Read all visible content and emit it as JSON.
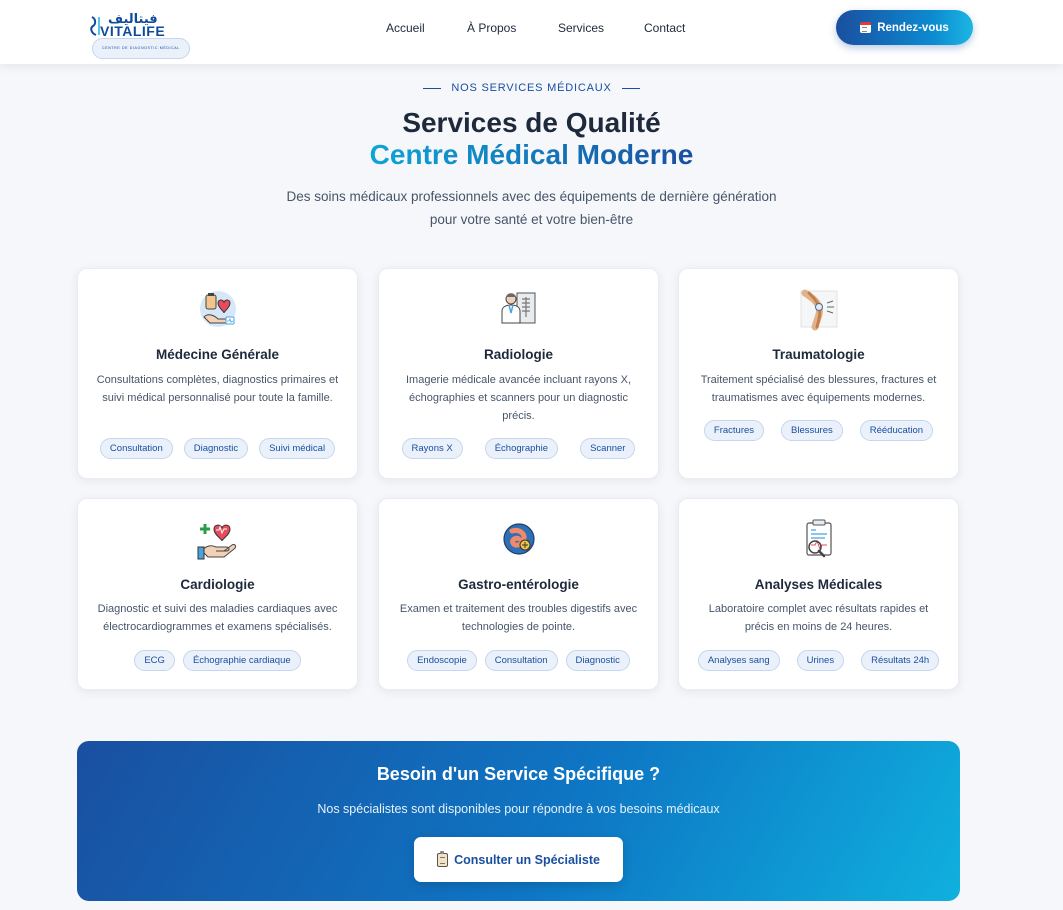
{
  "brand": {
    "arabic": "فيتاليف",
    "name": "VITALIFE",
    "tagline": "CENTRE DE DIAGNOSTIC MÉDICAL"
  },
  "nav": {
    "items": [
      {
        "label": "Accueil"
      },
      {
        "label": "À Propos"
      },
      {
        "label": "Services"
      },
      {
        "label": "Contact"
      }
    ],
    "cta_label": "Rendez-vous",
    "cta_icon": "calendar-icon"
  },
  "hero": {
    "eyebrow": "NOS SERVICES MÉDICAUX",
    "title_line1": "Services de Qualité",
    "title_line2": "Centre Médical Moderne",
    "subtitle_line1": "Des soins médicaux professionnels avec des équipements de dernière génération",
    "subtitle_line2": "pour votre santé et votre bien-être"
  },
  "services": [
    {
      "icon": "general-medicine-icon",
      "title": "Médecine Générale",
      "desc": "Consultations complètes, diagnostics primaires et suivi médical personnalisé pour toute la famille.",
      "tags": [
        "Consultation",
        "Diagnostic",
        "Suivi médical"
      ]
    },
    {
      "icon": "radiology-icon",
      "title": "Radiologie",
      "desc": "Imagerie médicale avancée incluant rayons X, échographies et scanners pour un diagnostic précis.",
      "tags": [
        "Rayons X",
        "Échographie",
        "Scanner"
      ]
    },
    {
      "icon": "knee-joint-icon",
      "title": "Traumatologie",
      "desc": "Traitement spécialisé des blessures, fractures et traumatismes avec équipements modernes.",
      "tags": [
        "Fractures",
        "Blessures",
        "Rééducation"
      ]
    },
    {
      "icon": "heart-hand-icon",
      "title": "Cardiologie",
      "desc": "Diagnostic et suivi des maladies cardiaques avec électrocardiogrammes et examens spécialisés.",
      "tags": [
        "ECG",
        "Échographie cardiaque"
      ]
    },
    {
      "icon": "stomach-icon",
      "title": "Gastro-entérologie",
      "desc": "Examen et traitement des troubles digestifs avec technologies de pointe.",
      "tags": [
        "Endoscopie",
        "Consultation",
        "Diagnostic"
      ]
    },
    {
      "icon": "lab-report-icon",
      "title": "Analyses Médicales",
      "desc": "Laboratoire complet avec résultats rapides et précis en moins de 24 heures.",
      "tags": [
        "Analyses sang",
        "Urines",
        "Résultats 24h"
      ]
    }
  ],
  "banner": {
    "title": "Besoin d'un Service Spécifique ?",
    "subtitle": "Nos spécialistes sont disponibles pour répondre à vos besoins médicaux",
    "button_label": "Consulter un Spécialiste",
    "button_icon": "clipboard-icon"
  },
  "colors": {
    "primary": "#1a4fa0",
    "accent": "#0ea5d8",
    "text": "#1e293b",
    "muted": "#475569",
    "background": "#f5f7fa"
  }
}
